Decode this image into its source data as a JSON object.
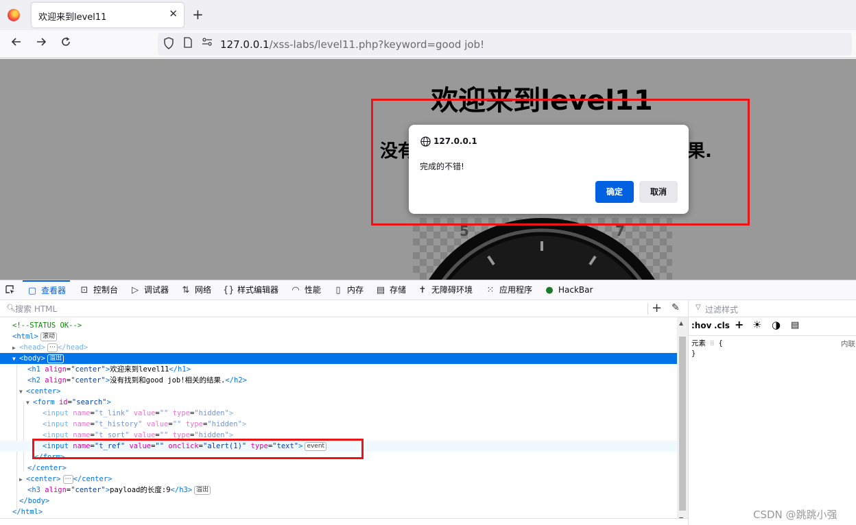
{
  "browser": {
    "tab_title": "欢迎来到level11",
    "tab_close": "✕",
    "new_tab": "+",
    "url_host": "127.0.0.1",
    "url_path": "/xss-labs/level11.php?keyword=good job!"
  },
  "page": {
    "h1": "欢迎来到level11",
    "h2_visible_start": "没有",
    "h2_visible_end": "果.",
    "clock_numbers": [
      "5",
      "7"
    ]
  },
  "dialog": {
    "host": "127.0.0.1",
    "message": "完成的不错!",
    "ok_label": "确定",
    "cancel_label": "取消"
  },
  "devtools": {
    "tabs": [
      {
        "icon": "inspector-icon",
        "label": "查看器",
        "active": true
      },
      {
        "icon": "console-icon",
        "label": "控制台"
      },
      {
        "icon": "debugger-icon",
        "label": "调试器"
      },
      {
        "icon": "network-icon",
        "label": "网络"
      },
      {
        "icon": "style-editor-icon",
        "label": "样式编辑器"
      },
      {
        "icon": "performance-icon",
        "label": "性能"
      },
      {
        "icon": "memory-icon",
        "label": "内存"
      },
      {
        "icon": "storage-icon",
        "label": "存储"
      },
      {
        "icon": "accessibility-icon",
        "label": "无障碍环境"
      },
      {
        "icon": "application-icon",
        "label": "应用程序"
      },
      {
        "icon": "hackbar-icon",
        "label": "HackBar"
      }
    ],
    "search_placeholder": "搜索 HTML",
    "rules_filter_placeholder": "过滤样式",
    "rules_tools": [
      ":hov",
      ".cls"
    ],
    "rules_element": "元素",
    "rules_open": "{",
    "rules_close": "}",
    "rules_inline": "内联",
    "markup": {
      "comment": "<!--STATUS OK-->",
      "html_open": "<html>",
      "badge_scroll": "滚动",
      "head_open": "<head>",
      "ellipsis": "⋯",
      "head_close": "</head>",
      "body_open": "<body>",
      "badge_overflow": "溢出",
      "h1_tag_open": "<h1",
      "attr_align": "align",
      "val_center": "\"center\"",
      "h1_text": "欢迎来到level11",
      "h1_close": "</h1>",
      "h2_tag_open": "<h2",
      "h2_text": "没有找到和good job!相关的结果.",
      "h2_close": "</h2>",
      "center_open": "<center>",
      "form_tag_open": "<form",
      "attr_id": "id",
      "val_search": "\"search\"",
      "tag_close_bracket": ">",
      "input_open": "<input",
      "attr_name": "name",
      "attr_value": "value",
      "attr_type": "type",
      "attr_onclick": "onclick",
      "val_empty": "\"\"",
      "val_t_link": "\"t_link\"",
      "val_t_history": "\"t_history\"",
      "val_t_sort": "\"t_sort\"",
      "val_t_ref": "\"t_ref\"",
      "val_hidden": "\"hidden\"",
      "val_alert": "\"alert(1)\"",
      "val_text": "\"text\"",
      "badge_event": "event",
      "form_close": "</form>",
      "center_close": "</center>",
      "h3_tag_open": "<h3",
      "h3_text": "payload的长度:9",
      "h3_close": "</h3>",
      "body_close": "</body>",
      "html_close": "</html>"
    }
  },
  "watermark": "CSDN @跳跳小强",
  "colors": {
    "accent": "#0060df",
    "highlight_box": "#e81416",
    "selected_row": "#0074e8",
    "ok_button": "#0061e0"
  }
}
